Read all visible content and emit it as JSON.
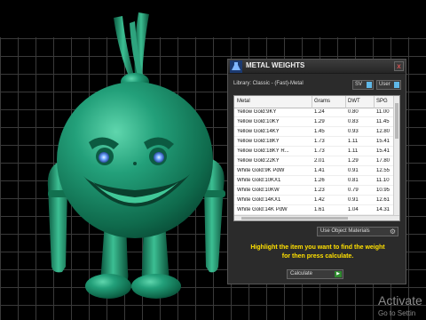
{
  "panel": {
    "title": "METAL WEIGHTS",
    "close_label": "x",
    "library_label": "Library: Classic - (Fast)-Metal",
    "option_buttons": [
      "SV",
      "User"
    ],
    "table": {
      "headers": [
        "Metal",
        "Grams",
        "DWT",
        "SPG"
      ],
      "rows": [
        [
          "Yellow Gold:9KY",
          "1.24",
          "0.80",
          "11.00"
        ],
        [
          "Yellow Gold:10KY",
          "1.29",
          "0.83",
          "11.45"
        ],
        [
          "Yellow Gold:14KY",
          "1.45",
          "0.93",
          "12.80"
        ],
        [
          "Yellow Gold:18KY",
          "1.73",
          "1.11",
          "15.41"
        ],
        [
          "Yellow Gold:18KY R...",
          "1.73",
          "1.11",
          "15.41"
        ],
        [
          "Yellow Gold:22KY",
          "2.01",
          "1.29",
          "17.80"
        ],
        [
          "White Gold:9K PdW",
          "1.41",
          "0.91",
          "12.55"
        ],
        [
          "White Gold:10KX1",
          "1.26",
          "0.81",
          "11.10"
        ],
        [
          "White Gold:10KW",
          "1.23",
          "0.79",
          "10.95"
        ],
        [
          "White Gold:14KX1",
          "1.42",
          "0.91",
          "12.61"
        ],
        [
          "White Gold:14K PdW",
          "1.61",
          "1.04",
          "14.31"
        ]
      ]
    },
    "use_object_materials_label": "Use Object Materials",
    "instruction_line1": "Highlight the item you want to find the weight",
    "instruction_line2": "for then press calculate.",
    "calculate_label": "Calculate"
  },
  "watermark": {
    "title": "Activate",
    "subtitle": "Go to Settin"
  },
  "colors": {
    "model_green": "#1f8a66",
    "instruction_yellow": "#ffe000",
    "eye_blue": "#6fa8ff"
  }
}
